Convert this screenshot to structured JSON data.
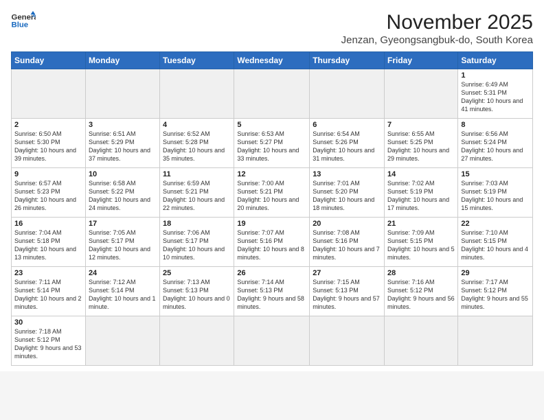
{
  "header": {
    "logo_general": "General",
    "logo_blue": "Blue",
    "month": "November 2025",
    "location": "Jenzan, Gyeongsangbuk-do, South Korea"
  },
  "weekdays": [
    "Sunday",
    "Monday",
    "Tuesday",
    "Wednesday",
    "Thursday",
    "Friday",
    "Saturday"
  ],
  "days": {
    "1": {
      "sunrise": "6:49 AM",
      "sunset": "5:31 PM",
      "daylight": "10 hours and 41 minutes."
    },
    "2": {
      "sunrise": "6:50 AM",
      "sunset": "5:30 PM",
      "daylight": "10 hours and 39 minutes."
    },
    "3": {
      "sunrise": "6:51 AM",
      "sunset": "5:29 PM",
      "daylight": "10 hours and 37 minutes."
    },
    "4": {
      "sunrise": "6:52 AM",
      "sunset": "5:28 PM",
      "daylight": "10 hours and 35 minutes."
    },
    "5": {
      "sunrise": "6:53 AM",
      "sunset": "5:27 PM",
      "daylight": "10 hours and 33 minutes."
    },
    "6": {
      "sunrise": "6:54 AM",
      "sunset": "5:26 PM",
      "daylight": "10 hours and 31 minutes."
    },
    "7": {
      "sunrise": "6:55 AM",
      "sunset": "5:25 PM",
      "daylight": "10 hours and 29 minutes."
    },
    "8": {
      "sunrise": "6:56 AM",
      "sunset": "5:24 PM",
      "daylight": "10 hours and 27 minutes."
    },
    "9": {
      "sunrise": "6:57 AM",
      "sunset": "5:23 PM",
      "daylight": "10 hours and 26 minutes."
    },
    "10": {
      "sunrise": "6:58 AM",
      "sunset": "5:22 PM",
      "daylight": "10 hours and 24 minutes."
    },
    "11": {
      "sunrise": "6:59 AM",
      "sunset": "5:21 PM",
      "daylight": "10 hours and 22 minutes."
    },
    "12": {
      "sunrise": "7:00 AM",
      "sunset": "5:21 PM",
      "daylight": "10 hours and 20 minutes."
    },
    "13": {
      "sunrise": "7:01 AM",
      "sunset": "5:20 PM",
      "daylight": "10 hours and 18 minutes."
    },
    "14": {
      "sunrise": "7:02 AM",
      "sunset": "5:19 PM",
      "daylight": "10 hours and 17 minutes."
    },
    "15": {
      "sunrise": "7:03 AM",
      "sunset": "5:19 PM",
      "daylight": "10 hours and 15 minutes."
    },
    "16": {
      "sunrise": "7:04 AM",
      "sunset": "5:18 PM",
      "daylight": "10 hours and 13 minutes."
    },
    "17": {
      "sunrise": "7:05 AM",
      "sunset": "5:17 PM",
      "daylight": "10 hours and 12 minutes."
    },
    "18": {
      "sunrise": "7:06 AM",
      "sunset": "5:17 PM",
      "daylight": "10 hours and 10 minutes."
    },
    "19": {
      "sunrise": "7:07 AM",
      "sunset": "5:16 PM",
      "daylight": "10 hours and 8 minutes."
    },
    "20": {
      "sunrise": "7:08 AM",
      "sunset": "5:16 PM",
      "daylight": "10 hours and 7 minutes."
    },
    "21": {
      "sunrise": "7:09 AM",
      "sunset": "5:15 PM",
      "daylight": "10 hours and 5 minutes."
    },
    "22": {
      "sunrise": "7:10 AM",
      "sunset": "5:15 PM",
      "daylight": "10 hours and 4 minutes."
    },
    "23": {
      "sunrise": "7:11 AM",
      "sunset": "5:14 PM",
      "daylight": "10 hours and 2 minutes."
    },
    "24": {
      "sunrise": "7:12 AM",
      "sunset": "5:14 PM",
      "daylight": "10 hours and 1 minute."
    },
    "25": {
      "sunrise": "7:13 AM",
      "sunset": "5:13 PM",
      "daylight": "10 hours and 0 minutes."
    },
    "26": {
      "sunrise": "7:14 AM",
      "sunset": "5:13 PM",
      "daylight": "9 hours and 58 minutes."
    },
    "27": {
      "sunrise": "7:15 AM",
      "sunset": "5:13 PM",
      "daylight": "9 hours and 57 minutes."
    },
    "28": {
      "sunrise": "7:16 AM",
      "sunset": "5:12 PM",
      "daylight": "9 hours and 56 minutes."
    },
    "29": {
      "sunrise": "7:17 AM",
      "sunset": "5:12 PM",
      "daylight": "9 hours and 55 minutes."
    },
    "30": {
      "sunrise": "7:18 AM",
      "sunset": "5:12 PM",
      "daylight": "9 hours and 53 minutes."
    }
  }
}
